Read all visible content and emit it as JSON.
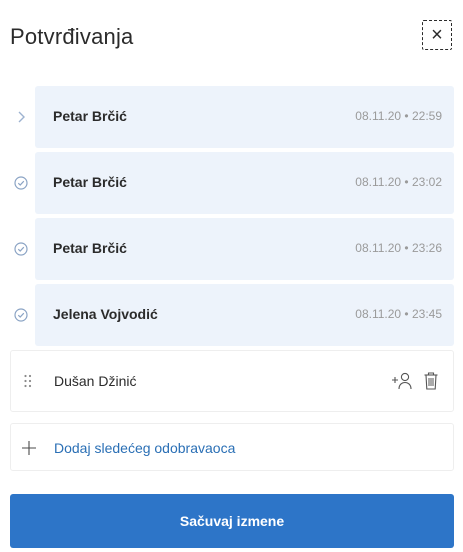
{
  "header": {
    "title": "Potvrđivanja",
    "close_icon": "close-icon",
    "close_glyph": "×"
  },
  "approvals": [
    {
      "name": "Petar Brčić",
      "time": "08.11.20 • 22:59",
      "icon": "chevron-right-icon"
    },
    {
      "name": "Petar Brčić",
      "time": "08.11.20 • 23:02",
      "icon": "check-circle-icon"
    },
    {
      "name": "Petar Brčić",
      "time": "08.11.20 • 23:26",
      "icon": "check-circle-icon"
    },
    {
      "name": "Jelena Vojvodić",
      "time": "08.11.20 • 23:45",
      "icon": "check-circle-icon"
    }
  ],
  "pending": {
    "name": "Dušan Džinić",
    "icons": [
      "drag-handle-icon",
      "add-user-icon",
      "trash-icon"
    ]
  },
  "add_approver": {
    "label": "Dodaj sledećeg odobravaoca",
    "icon": "plus-icon"
  },
  "save_button": {
    "label": "Sačuvaj izmene"
  },
  "colors": {
    "row_background": "#edf3fb",
    "accent": "#2d75c8",
    "link": "#2a6fb5",
    "icon_muted": "#8aa3c4"
  }
}
